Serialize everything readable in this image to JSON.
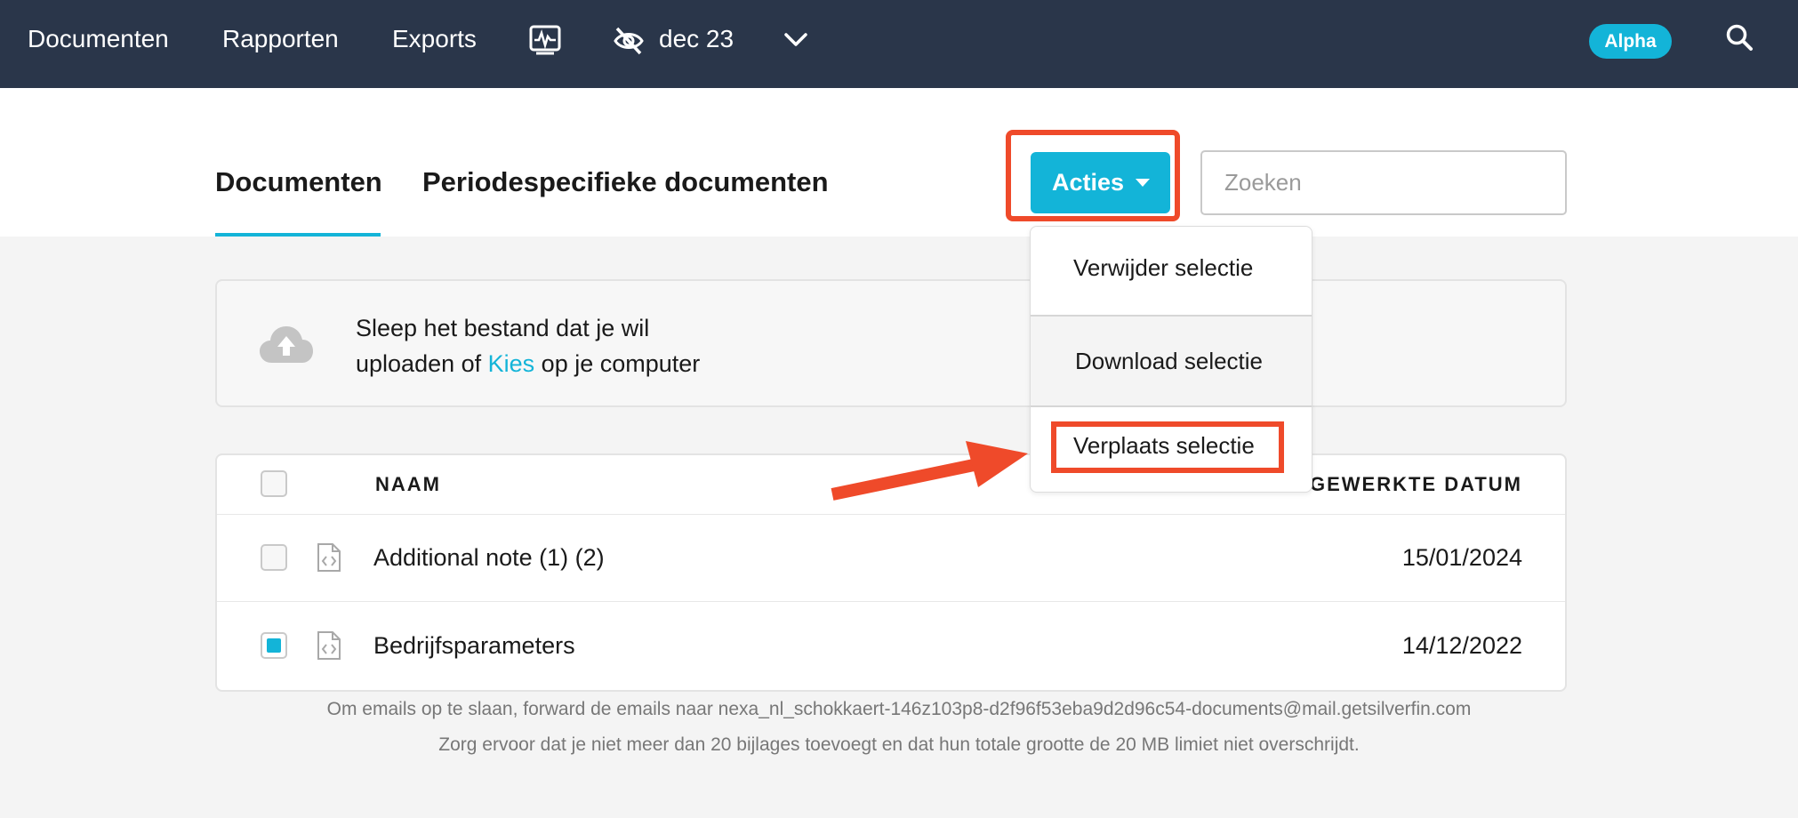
{
  "topnav": {
    "items": [
      "Documenten",
      "Rapporten",
      "Exports"
    ],
    "period": "dec 23",
    "badge": "Alpha"
  },
  "tabs": {
    "documents": "Documenten",
    "period_documents": "Periodespecifieke documenten"
  },
  "actions": {
    "button_label": "Acties",
    "menu": [
      "Verwijder selectie",
      "Download selectie",
      "Verplaats selectie"
    ]
  },
  "search": {
    "placeholder": "Zoeken"
  },
  "upload": {
    "line1": "Sleep het bestand dat je wil",
    "line2_prefix": "uploaden of ",
    "link": "Kies",
    "line2_suffix": " op je computer"
  },
  "table": {
    "headers": {
      "name": "NAAM",
      "date": "UGEWERKTE DATUM"
    },
    "rows": [
      {
        "name": "Additional note (1) (2)",
        "date": "15/01/2024",
        "checked": false
      },
      {
        "name": "Bedrijfsparameters",
        "date": "14/12/2022",
        "checked": true
      }
    ]
  },
  "footer": {
    "line1": "Om emails op te slaan, forward de emails naar nexa_nl_schokkaert-146z103p8-d2f96f53eba9d2d96c54-documents@mail.getsilverfin.com",
    "line2": "Zorg ervoor dat je niet meer dan 20 bijlages toevoegt en dat hun totale grootte de 20 MB limiet niet overschrijdt."
  },
  "colors": {
    "nav_bg": "#2a364a",
    "accent": "#13b4d8",
    "highlight": "#ef4a2a"
  },
  "icons": [
    "activity-monitor-icon",
    "eye-off-icon",
    "chevron-down-icon",
    "search-icon",
    "cloud-upload-icon",
    "code-file-icon",
    "caret-down-icon"
  ]
}
